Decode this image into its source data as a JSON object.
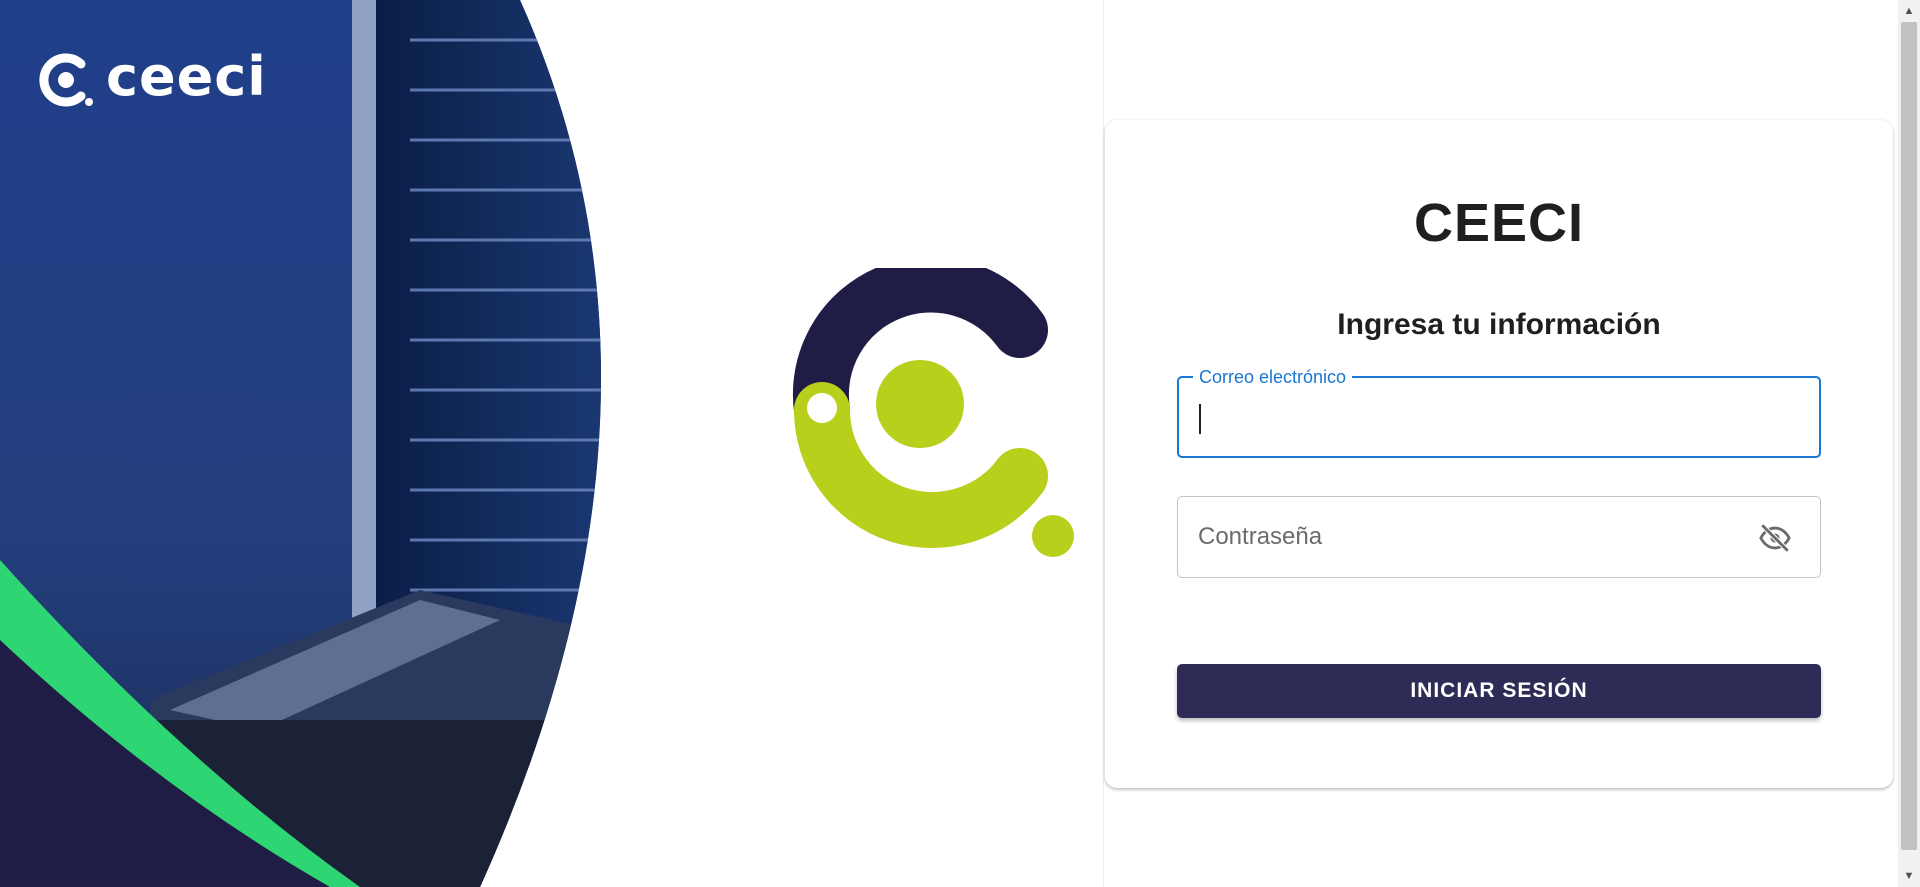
{
  "brand": {
    "name": "ceeci",
    "colors": {
      "navy": "#1f1c45",
      "lime": "#b8cf1b",
      "green": "#2ed573",
      "button": "#2e2b56",
      "focus": "#1976d2"
    }
  },
  "left_panel": {
    "logo_icon": "ceeci-c-icon",
    "emblem_icon": "ceeci-emblem-icon"
  },
  "login_card": {
    "title": "CEECI",
    "subtitle": "Ingresa tu información",
    "email": {
      "label": "Correo electrónico",
      "value": ""
    },
    "password": {
      "placeholder": "Contraseña",
      "value": "",
      "toggle_icon": "eye-off-icon"
    },
    "submit_label": "INICIAR SESIÓN"
  },
  "scrollbar": {
    "up_icon": "arrow-up-icon",
    "down_icon": "arrow-down-icon"
  }
}
